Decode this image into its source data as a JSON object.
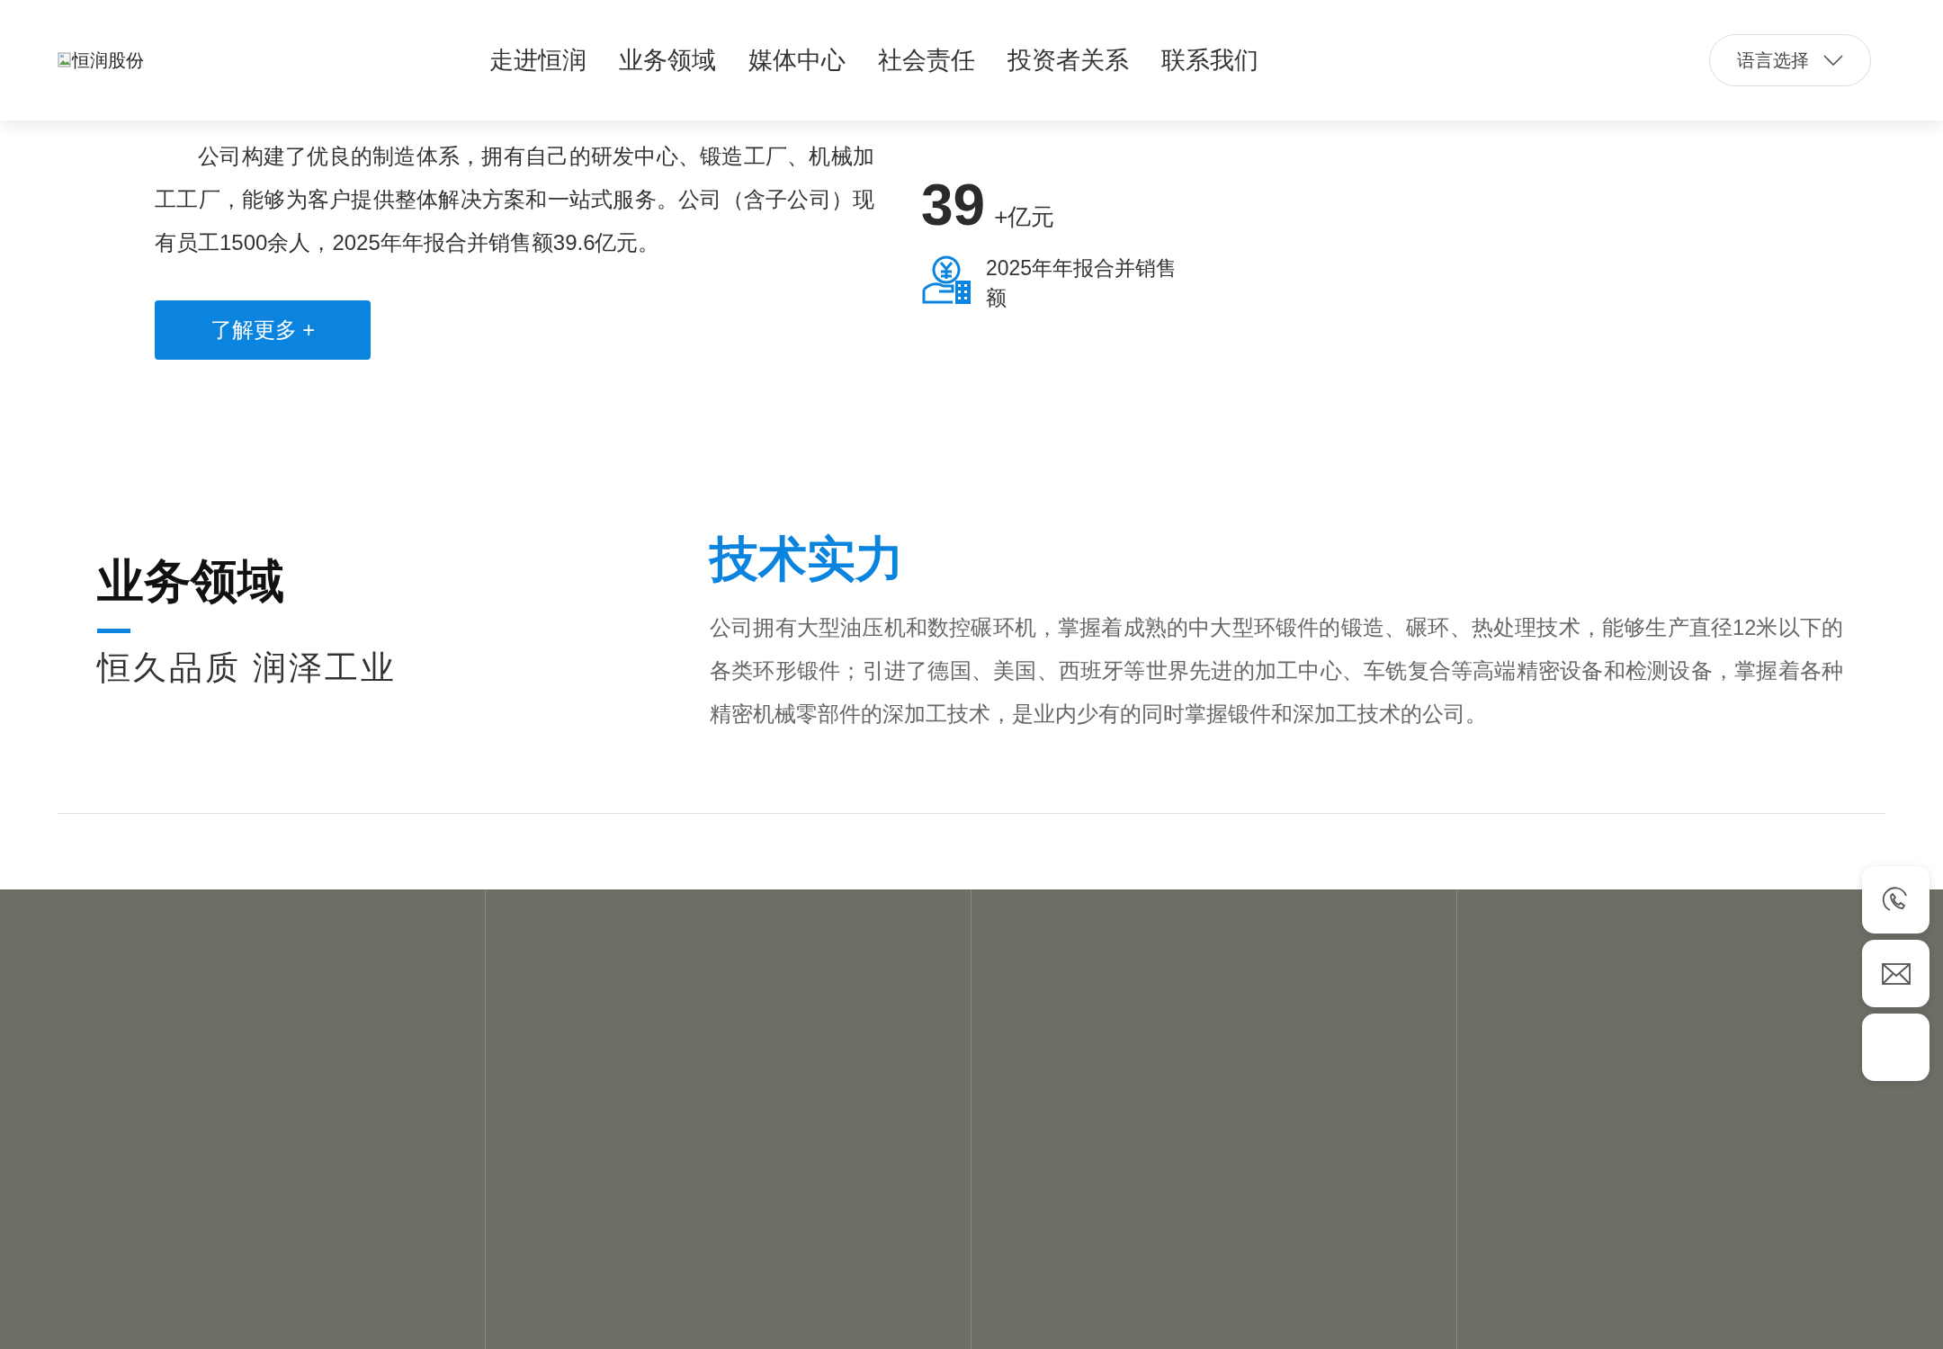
{
  "header": {
    "logo": "恒润股份",
    "nav": [
      "走进恒润",
      "业务领域",
      "媒体中心",
      "社会责任",
      "投资者关系",
      "联系我们"
    ],
    "language_button": "语言选择"
  },
  "intro": {
    "paragraph": "公司构建了优良的制造体系，拥有自己的研发中心、锻造工厂、机械加工工厂，能够为客户提供整体解决方案和一站式服务。公司（含子公司）现有员工1500余人，2025年年报合并销售额39.6亿元。",
    "button": "了解更多 +",
    "stat": {
      "value": "39",
      "unit": "+亿元",
      "label": "2025年年报合并销售额"
    }
  },
  "business": {
    "title": "业务领域",
    "slogan": "恒久品质 润泽工业"
  },
  "tech": {
    "title": "技术实力",
    "text": "公司拥有大型油压机和数控碾环机，掌握着成熟的中大型环锻件的锻造、碾环、热处理技术，能够生产直径12米以下的各类环形锻件；引进了德国、美国、西班牙等世界先进的加工中心、车铣复合等高端精密设备和检测设备，掌握着各种精密机械零部件的深加工技术，是业内少有的同时掌握锻件和深加工技术的公司。"
  },
  "side_buttons": [
    {
      "kind": "phone"
    },
    {
      "kind": "mail"
    },
    {
      "kind": "blank"
    }
  ]
}
